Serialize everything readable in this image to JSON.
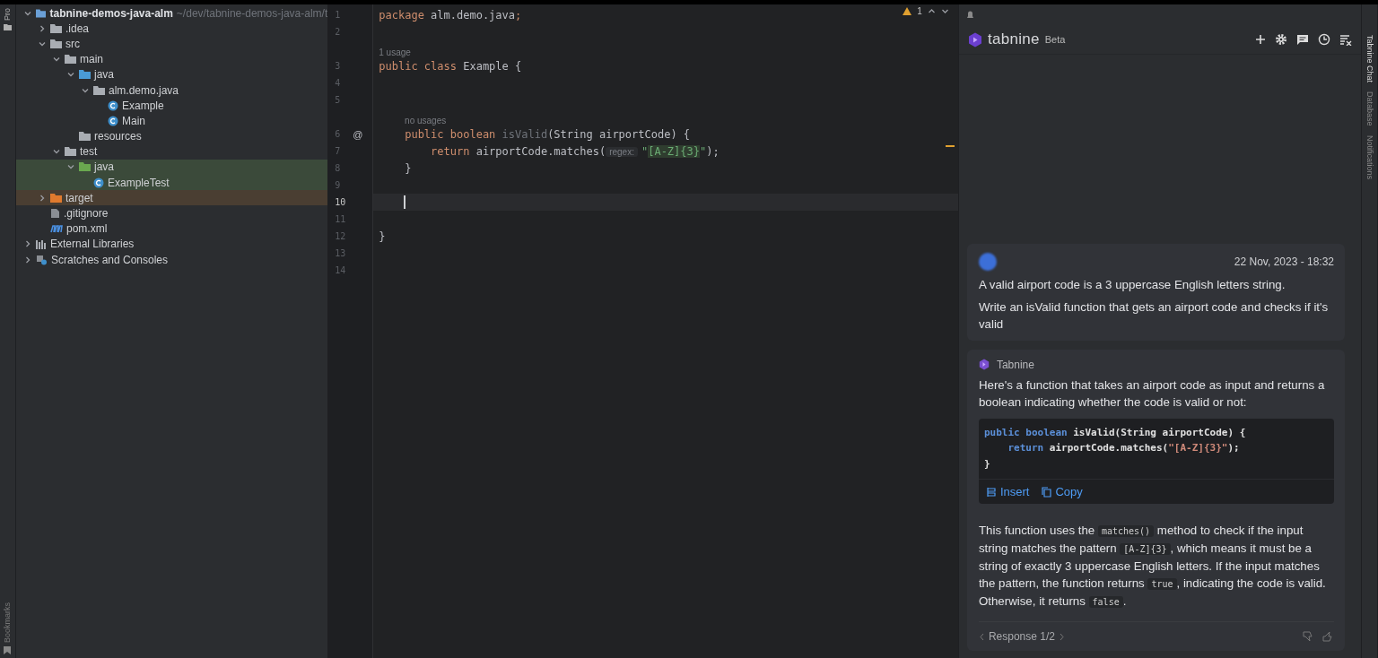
{
  "left_strip": {
    "top_label": "Pro",
    "bottom_label": "Bookmarks"
  },
  "project_tree": {
    "items": [
      {
        "label": "tabnine-demos-java-alm",
        "path": "~/dev/tabnine-demos-java-alm/t",
        "kind": "module",
        "expanded": true,
        "children": [
          {
            "label": ".idea",
            "kind": "folder",
            "expanded": false
          },
          {
            "label": "src",
            "kind": "folder",
            "expanded": true,
            "children": [
              {
                "label": "main",
                "kind": "folder",
                "expanded": true,
                "children": [
                  {
                    "label": "java",
                    "kind": "source",
                    "expanded": true,
                    "children": [
                      {
                        "label": "alm.demo.java",
                        "kind": "package",
                        "expanded": true,
                        "children": [
                          {
                            "label": "Example",
                            "kind": "class"
                          },
                          {
                            "label": "Main",
                            "kind": "class"
                          }
                        ]
                      }
                    ]
                  },
                  {
                    "label": "resources",
                    "kind": "resources"
                  }
                ]
              },
              {
                "label": "test",
                "kind": "folder",
                "expanded": true,
                "children": [
                  {
                    "label": "java",
                    "kind": "test-source",
                    "expanded": true,
                    "color": "#3b4a3a",
                    "children": [
                      {
                        "label": "ExampleTest",
                        "kind": "class",
                        "color": "#3b4a3a"
                      }
                    ]
                  }
                ]
              }
            ]
          },
          {
            "label": "target",
            "kind": "excluded",
            "expanded": false,
            "color": "#4a3e32"
          },
          {
            "label": ".gitignore",
            "kind": "file"
          },
          {
            "label": "pom.xml",
            "kind": "maven"
          }
        ]
      },
      {
        "label": "External Libraries",
        "kind": "libraries",
        "expanded": false
      },
      {
        "label": "Scratches and Consoles",
        "kind": "scratches",
        "expanded": false
      }
    ]
  },
  "editor": {
    "warnings": "1",
    "lines": [
      {
        "number": "1",
        "tokens": [
          {
            "kind": "keyword",
            "text": "package "
          },
          {
            "kind": "plain",
            "text": "alm.demo.java"
          },
          {
            "kind": "keyword",
            "text": ";"
          }
        ]
      },
      {
        "number": "2"
      },
      {
        "number": "3",
        "hint": "1 usage",
        "tokens": [
          {
            "kind": "keyword",
            "text": "public class "
          },
          {
            "kind": "plain",
            "text": "Example {"
          }
        ]
      },
      {
        "number": "4"
      },
      {
        "number": "5"
      },
      {
        "number": "6",
        "hint": "no usages",
        "gutter_mark": "@",
        "tokens": [
          {
            "kind": "keyword",
            "text": "    public boolean "
          },
          {
            "kind": "unused",
            "text": "isValid"
          },
          {
            "kind": "plain",
            "text": "(String airportCode) {"
          }
        ]
      },
      {
        "number": "7",
        "tokens": [
          {
            "kind": "keyword",
            "text": "        return "
          },
          {
            "kind": "plain",
            "text": "airportCode.matches("
          },
          {
            "kind": "param-hint",
            "text": "regex:"
          },
          {
            "kind": "string",
            "text": "\""
          },
          {
            "kind": "regex",
            "text": "[A-Z]{3}"
          },
          {
            "kind": "string",
            "text": "\""
          },
          {
            "kind": "plain",
            "text": ");"
          }
        ]
      },
      {
        "number": "8",
        "tokens": [
          {
            "kind": "plain",
            "text": "    }"
          }
        ]
      },
      {
        "number": "9"
      },
      {
        "number": "10",
        "current": true
      },
      {
        "number": "11"
      },
      {
        "number": "12",
        "tokens": [
          {
            "kind": "plain",
            "text": "}"
          }
        ]
      },
      {
        "number": "13"
      },
      {
        "number": "14"
      }
    ]
  },
  "chat": {
    "title": "tabnine",
    "badge": "Beta",
    "messages": [
      {
        "kind": "user",
        "time": "22 Nov, 2023 - 18:32",
        "paragraphs": [
          [
            {
              "kind": "text",
              "text": "A valid airport code is a 3 uppercase English letters string."
            }
          ],
          [
            {
              "kind": "text",
              "text": "Write an isValid function that gets an airport code and checks if it's valid"
            }
          ]
        ]
      },
      {
        "kind": "bot",
        "author": "Tabnine",
        "paragraphs": [
          [
            {
              "kind": "text",
              "text": "Here's a function that takes an airport code as input and returns a boolean indicating whether the code is valid or not:"
            }
          ]
        ],
        "code": [
          [
            {
              "kind": "keyword",
              "text": "public boolean "
            },
            {
              "kind": "plain",
              "text": "isValid(String airportCode) {"
            }
          ],
          [
            {
              "kind": "keyword",
              "text": "    return "
            },
            {
              "kind": "plain",
              "text": "airportCode.matches("
            },
            {
              "kind": "string",
              "text": "\"[A-Z]{3}\""
            },
            {
              "kind": "plain",
              "text": ");"
            }
          ],
          [
            {
              "kind": "plain",
              "text": "}"
            }
          ]
        ],
        "actions": [
          "Insert",
          "Copy"
        ],
        "after": [
          [
            {
              "kind": "text",
              "text": "This function uses the "
            },
            {
              "kind": "code",
              "text": "matches()"
            },
            {
              "kind": "text",
              "text": " method to check if the input string matches the pattern "
            },
            {
              "kind": "code",
              "text": "[A-Z]{3}"
            },
            {
              "kind": "text",
              "text": ", which means it must be a string of exactly 3 uppercase English letters. If the input matches the pattern, the function returns "
            },
            {
              "kind": "code",
              "text": "true"
            },
            {
              "kind": "text",
              "text": ", indicating the code is valid. Otherwise, it returns "
            },
            {
              "kind": "code",
              "text": "false"
            },
            {
              "kind": "text",
              "text": "."
            }
          ]
        ],
        "pager": "Response 1/2"
      }
    ]
  },
  "right_strip": {
    "labels": [
      "Tabnine Chat",
      "Database",
      "Notifications"
    ]
  }
}
